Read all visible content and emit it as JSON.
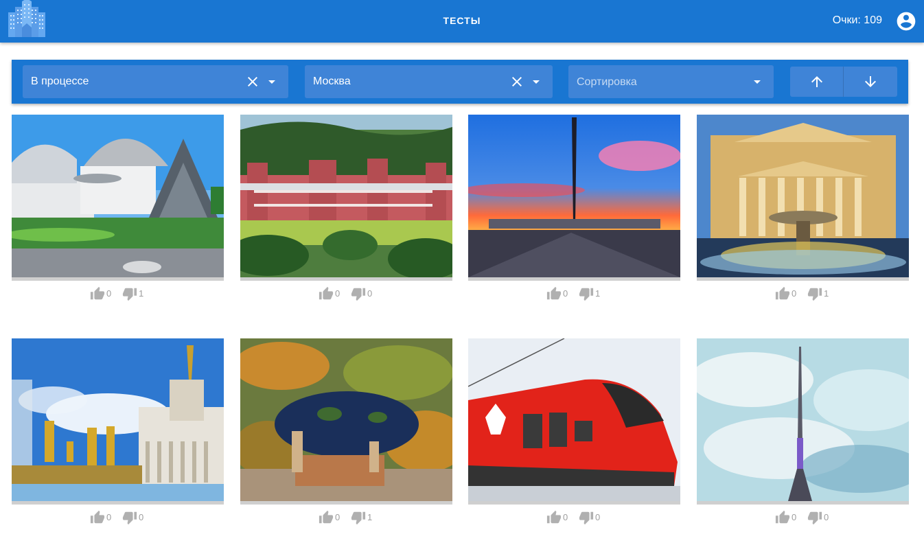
{
  "header": {
    "title": "ТЕСТЫ",
    "score_text": "Очки: 109"
  },
  "filters": {
    "status": {
      "value": "В процессе"
    },
    "city": {
      "value": "Москва"
    },
    "sort": {
      "placeholder": "Сортировка"
    }
  },
  "cards": [
    {
      "image": "planetarium",
      "likes": "0",
      "dislikes": "1"
    },
    {
      "image": "tsaritsyno-palace",
      "likes": "0",
      "dislikes": "0"
    },
    {
      "image": "victory-park-obelisk",
      "likes": "0",
      "dislikes": "1"
    },
    {
      "image": "bolshoi-theatre",
      "likes": "0",
      "dislikes": "1"
    },
    {
      "image": "vdnh-fountain",
      "likes": "0",
      "dislikes": "0"
    },
    {
      "image": "moscow-zoo",
      "likes": "0",
      "dislikes": "1"
    },
    {
      "image": "aeroexpress-train",
      "likes": "0",
      "dislikes": "0"
    },
    {
      "image": "ostankino-tower",
      "likes": "0",
      "dislikes": "0"
    }
  ],
  "colors": {
    "primary": "#1976d2",
    "field": "#3f84d7",
    "vote_icon": "#b0b0b0"
  }
}
